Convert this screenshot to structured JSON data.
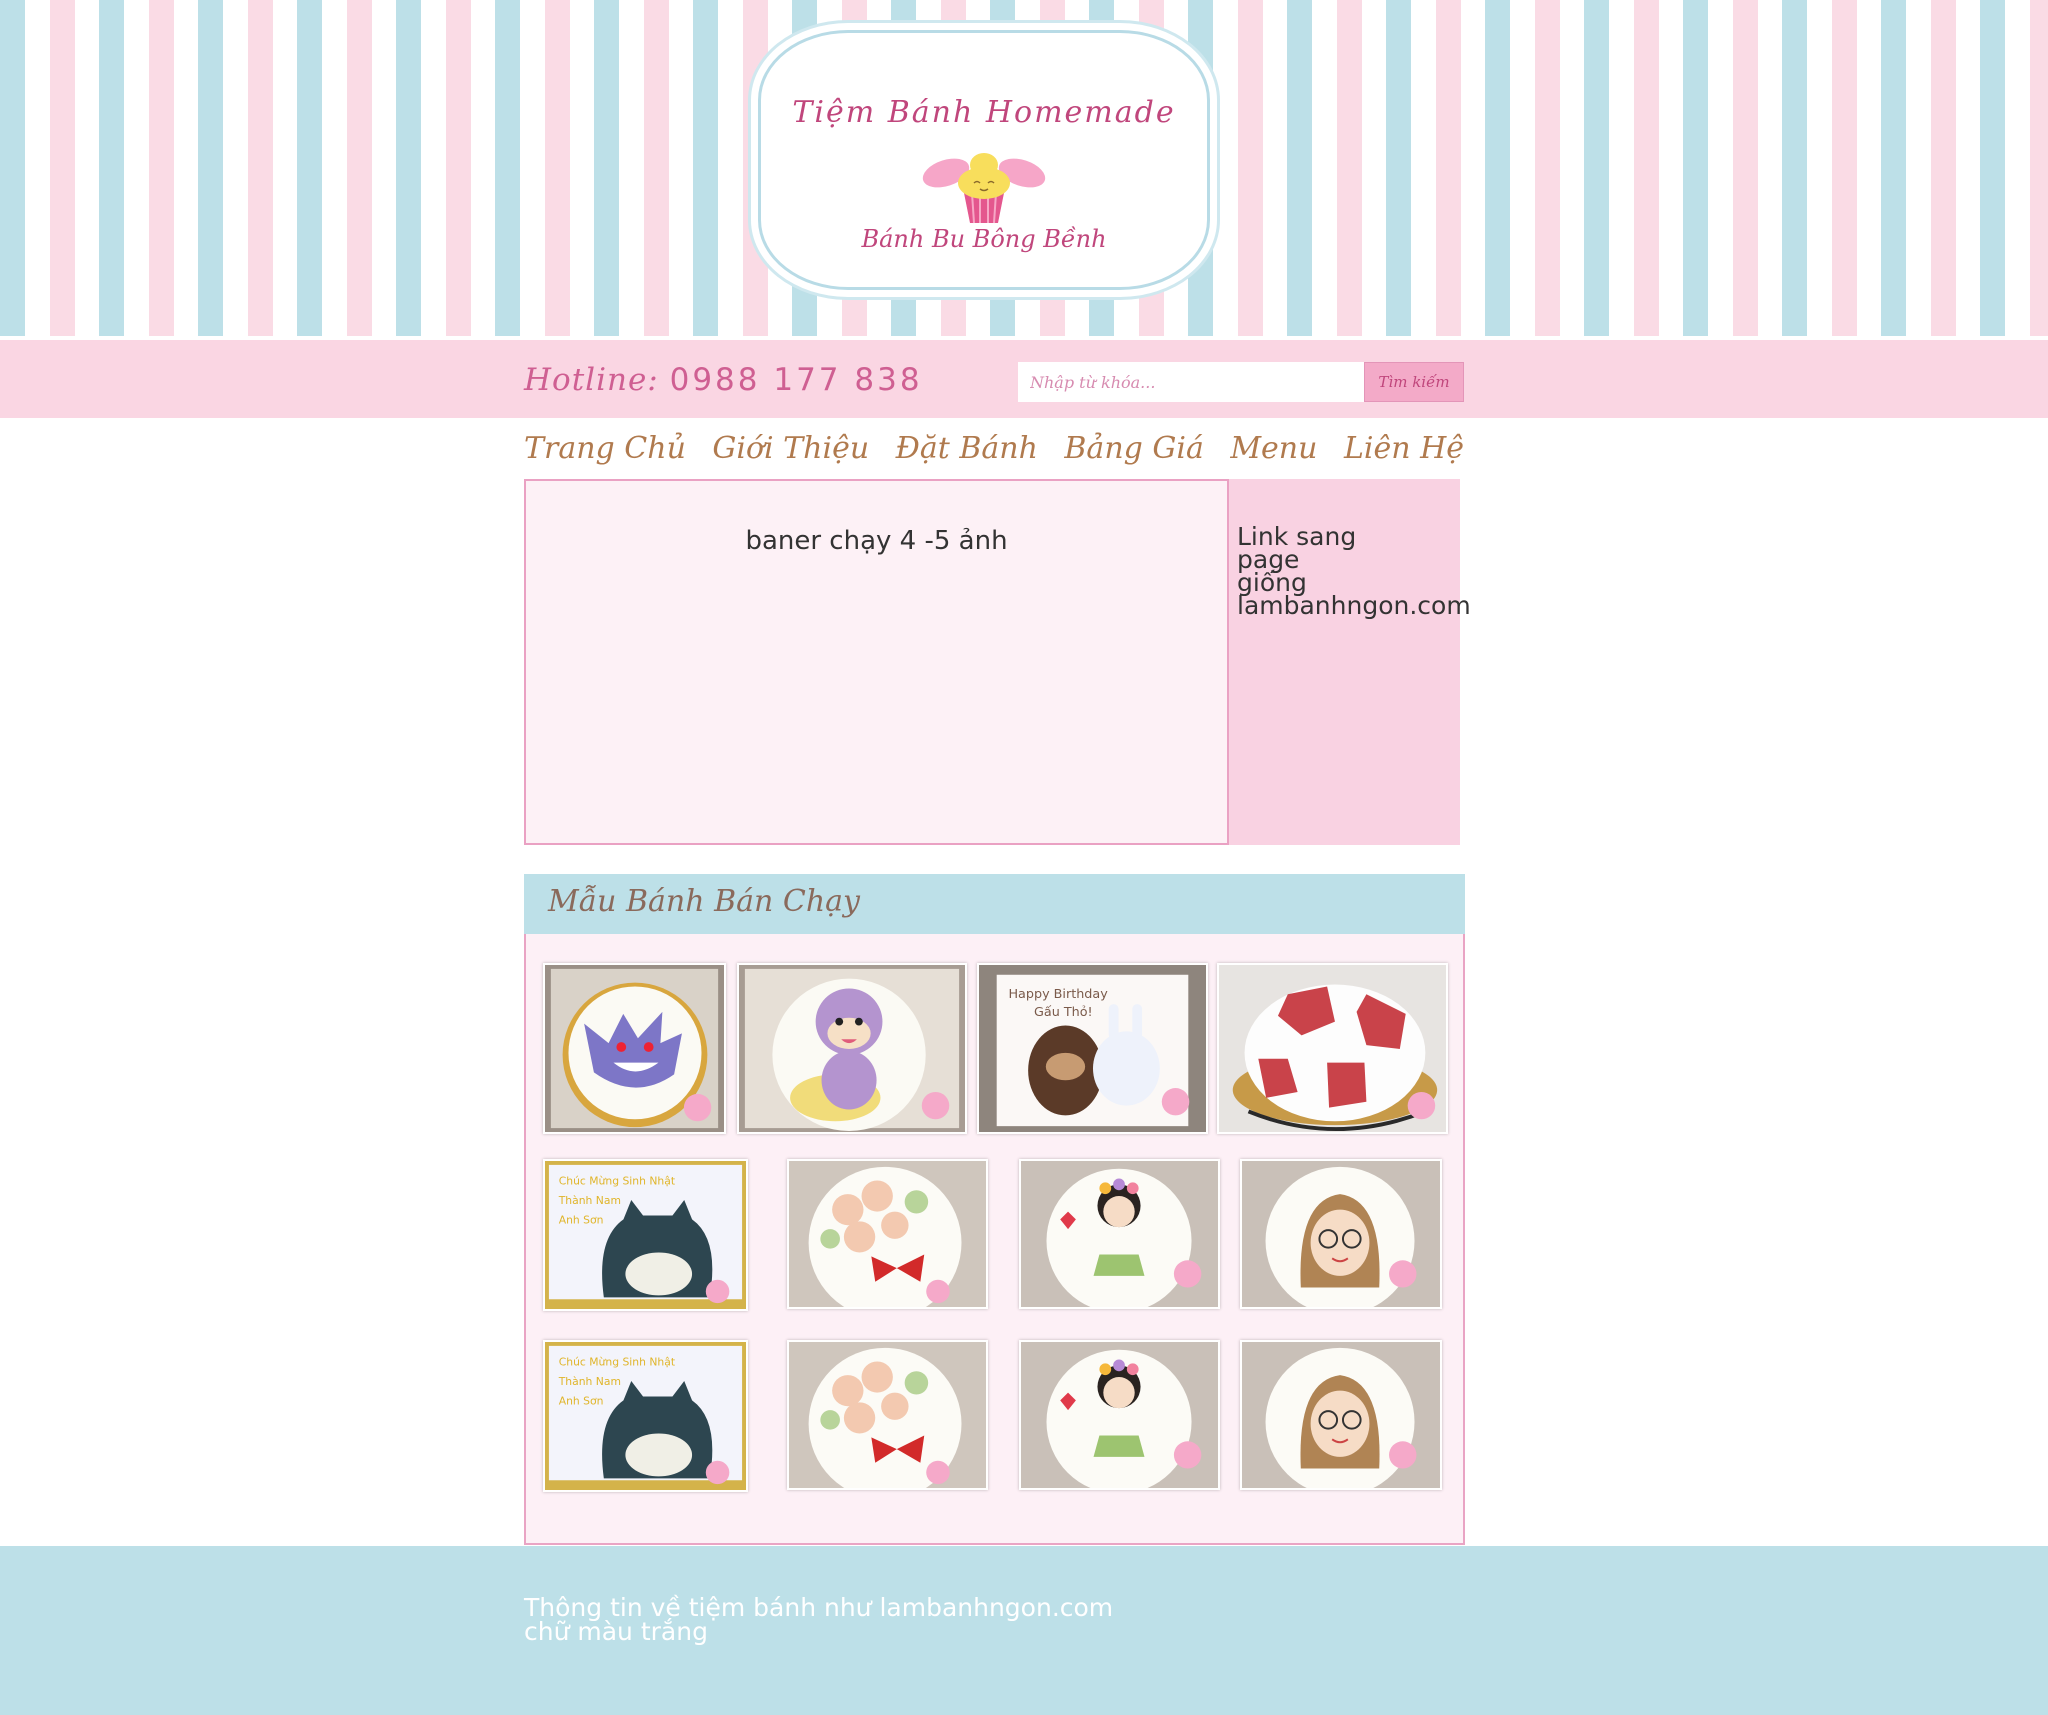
{
  "logo": {
    "title": "Tiệm Bánh Homemade",
    "subtitle": "Bánh Bu Bông Bềnh",
    "icon": "cupcake-with-wings-icon"
  },
  "header": {
    "hotline_label": "Hotline:",
    "hotline_number": "0988 177 838",
    "search_placeholder": "Nhập từ khóa...",
    "search_button": "Tìm kiếm"
  },
  "nav": {
    "items": [
      {
        "label": "Trang Chủ"
      },
      {
        "label": "Giới Thiệu"
      },
      {
        "label": "Đặt Bánh"
      },
      {
        "label": "Bảng Giá"
      },
      {
        "label": "Menu"
      },
      {
        "label": "Liên Hệ"
      }
    ]
  },
  "banner": {
    "text": "baner chạy 4 -5 ảnh"
  },
  "side_link": {
    "text": "Link sang\npage\ngiống\nlambanhngon.com"
  },
  "best_sellers": {
    "title": "Mẫu Bánh Bán Chạy",
    "photos": [
      {
        "subject": "gengar-cake"
      },
      {
        "subject": "monkey-cake"
      },
      {
        "subject": "bear-bunny-cake"
      },
      {
        "subject": "soccer-ball-cake"
      },
      {
        "subject": "snorlax-batman-cake"
      },
      {
        "subject": "rose-flower-cake"
      },
      {
        "subject": "hula-girl-cake"
      },
      {
        "subject": "glasses-girl-cake"
      },
      {
        "subject": "snorlax-batman-cake"
      },
      {
        "subject": "rose-flower-cake"
      },
      {
        "subject": "hula-girl-cake"
      },
      {
        "subject": "glasses-girl-cake"
      }
    ]
  },
  "footer": {
    "text": "Thông tin về tiệm bánh như lambanhngon.com\nchữ màu trắng"
  },
  "colors": {
    "pink": "#fad6e3",
    "blue": "#bde0e8",
    "accent": "#c0467c"
  }
}
